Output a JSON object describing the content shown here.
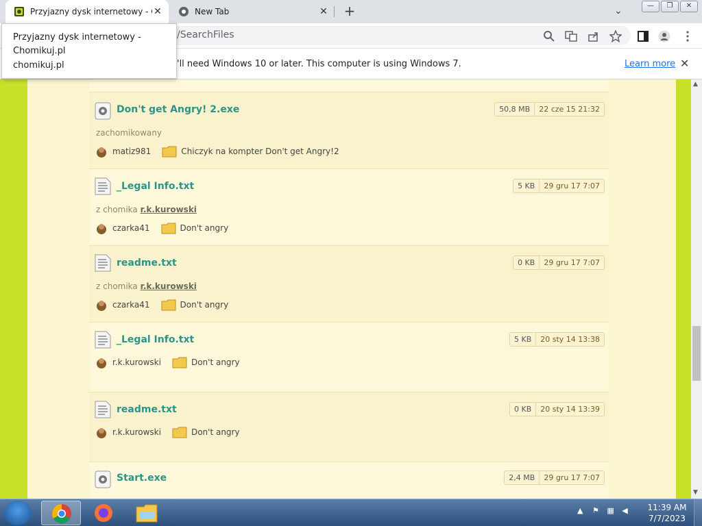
{
  "browser": {
    "tabs": [
      {
        "title": "Przyjazny dysk internetowy - Chomikuj.pl",
        "active": true
      },
      {
        "title": "New Tab",
        "active": false
      }
    ],
    "new_tab_symbol": "+",
    "close_symbol": "✕",
    "url_fragment": "/SearchFiles",
    "toolbar_icons": [
      "search-icon",
      "translate-icon",
      "share-icon",
      "star-icon",
      "sidebar-icon",
      "profile-icon",
      "menu-icon"
    ],
    "tooltip": {
      "title": "Przyjazny dysk internetowy - Chomikuj.pl",
      "host": "chomikuj.pl"
    },
    "infobar": {
      "message": "'ll need Windows 10 or later. This computer is using Windows 7.",
      "learn_more": "Learn more",
      "close": "✕"
    }
  },
  "results": [
    {
      "name": "Don't get Angry! 2.exe",
      "icon": "exe-gear-icon",
      "size": "50,8 MB",
      "date": "22 cze 15 21:32",
      "origin_text": "zachomikowany",
      "origin_user": "",
      "owner": "matiz981",
      "folder": "Chiczyk na kompter Don't get Angry!2"
    },
    {
      "name": "_Legal Info.txt",
      "icon": "txt-file-icon",
      "size": "5 KB",
      "date": "29 gru 17 7:07",
      "origin_text": "z chomika",
      "origin_user": "r.k.kurowski",
      "owner": "czarka41",
      "folder": "Don't angry"
    },
    {
      "name": "readme.txt",
      "icon": "txt-file-icon",
      "size": "0 KB",
      "date": "29 gru 17 7:07",
      "origin_text": "z chomika",
      "origin_user": "r.k.kurowski",
      "owner": "czarka41",
      "folder": "Don't angry"
    },
    {
      "name": "_Legal Info.txt",
      "icon": "txt-file-icon",
      "size": "5 KB",
      "date": "20 sty 14 13:38",
      "origin_text": "",
      "origin_user": "",
      "owner": "r.k.kurowski",
      "folder": "Don't angry"
    },
    {
      "name": "readme.txt",
      "icon": "txt-file-icon",
      "size": "0 KB",
      "date": "20 sty 14 13:39",
      "origin_text": "",
      "origin_user": "",
      "owner": "r.k.kurowski",
      "folder": "Don't angry"
    },
    {
      "name": "Start.exe",
      "icon": "exe-gear-icon",
      "size": "2,4 MB",
      "date": "29 gru 17 7:07",
      "origin_text": "",
      "origin_user": "",
      "owner": "",
      "folder": ""
    }
  ],
  "taskbar": {
    "items": [
      "chrome-icon",
      "firefox-icon",
      "explorer-icon"
    ],
    "tray_symbol": "▲",
    "time": "11:39 AM",
    "date": "7/7/2023"
  },
  "colors": {
    "page_background": "#c9e02a",
    "paper": "#fbf5d0",
    "file_link": "#2b9488",
    "infobar_link": "#1a73e8"
  }
}
